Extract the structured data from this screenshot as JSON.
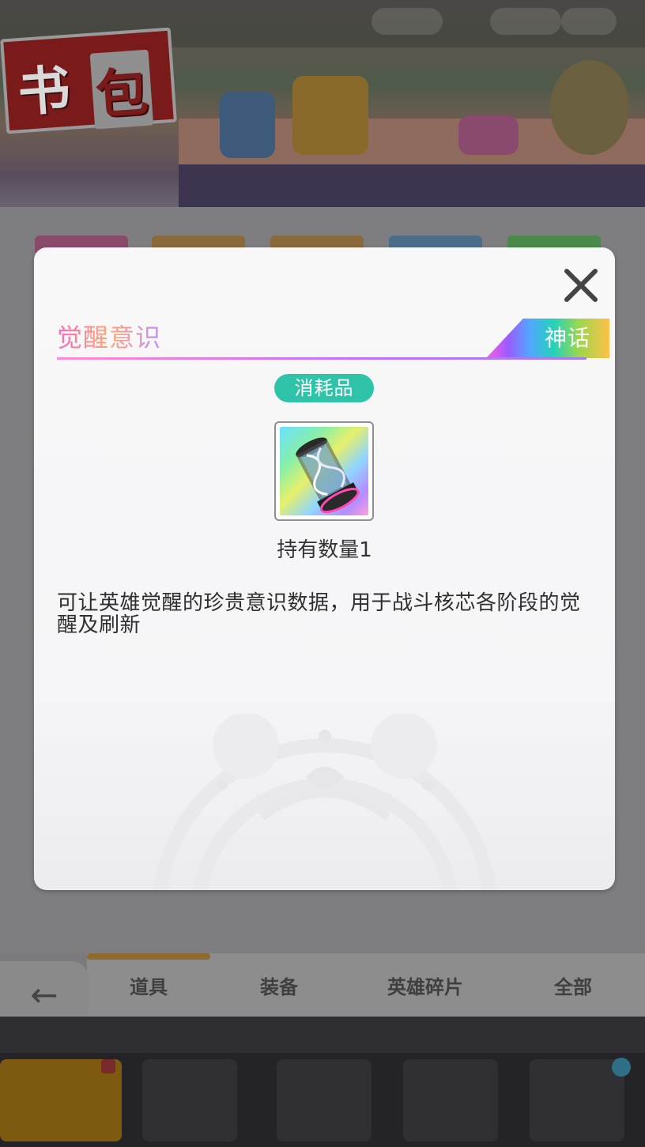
{
  "background": {
    "banner_title": [
      "书",
      "包"
    ],
    "tabs": [
      "道具",
      "装备",
      "英雄碎片",
      "全部"
    ],
    "back_label": "返回"
  },
  "modal": {
    "item_name": "觉醒意识",
    "rarity": "神话",
    "category": "消耗品",
    "owned": "持有数量1",
    "description": "可让英雄觉醒的珍贵意识数据，用于战斗核芯各阶段的觉醒及刷新",
    "close_icon": "close-icon"
  }
}
